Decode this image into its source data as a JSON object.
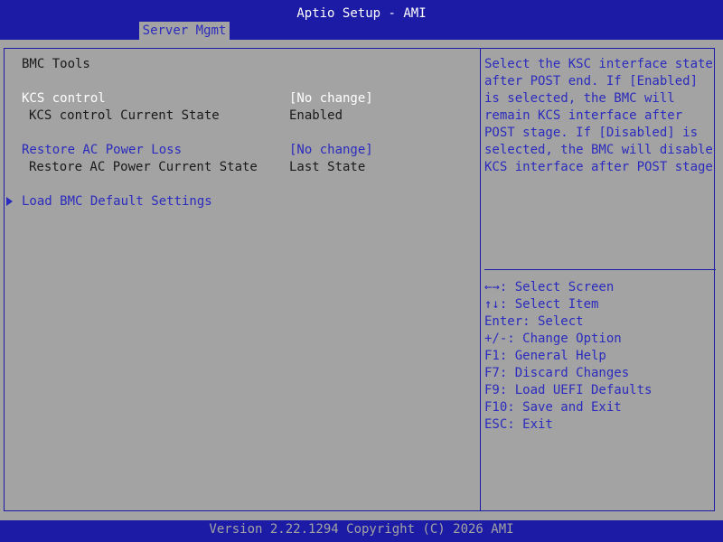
{
  "header": {
    "title": "Aptio Setup - AMI",
    "tab_label": "Server Mgmt"
  },
  "main": {
    "section_title": "BMC Tools",
    "kcs_control_label": "KCS control",
    "kcs_control_value": "[No change]",
    "kcs_state_label": "KCS control Current State",
    "kcs_state_value": "Enabled",
    "restore_ac_label": "Restore AC Power Loss",
    "restore_ac_value": "[No change]",
    "restore_ac_state_label": "Restore AC Power Current State",
    "restore_ac_state_value": "Last State",
    "load_defaults_label": "Load BMC Default Settings"
  },
  "help": {
    "text": "Select the KSC interface state\nafter POST end. If [Enabled]\nis selected, the BMC will\nremain KCS interface after\nPOST stage. If [Disabled] is\nselected, the BMC will disable\nKCS interface after POST stage"
  },
  "keys": [
    "←→: Select Screen",
    "↑↓: Select Item",
    "Enter: Select",
    "+/-: Change Option",
    "F1: General Help",
    "F7: Discard Changes",
    "F9: Load UEFI Defaults",
    "F10: Save and Exit",
    "ESC: Exit"
  ],
  "footer": {
    "version": "Version 2.22.1294 Copyright (C) 2026 AMI"
  },
  "colors": {
    "bar_blue": "#1b1ba5",
    "panel_gray": "#a3a3a3",
    "accent_blue": "#2b2bbd",
    "text_white": "#ffffff",
    "text_black": "#1a1a1a"
  }
}
